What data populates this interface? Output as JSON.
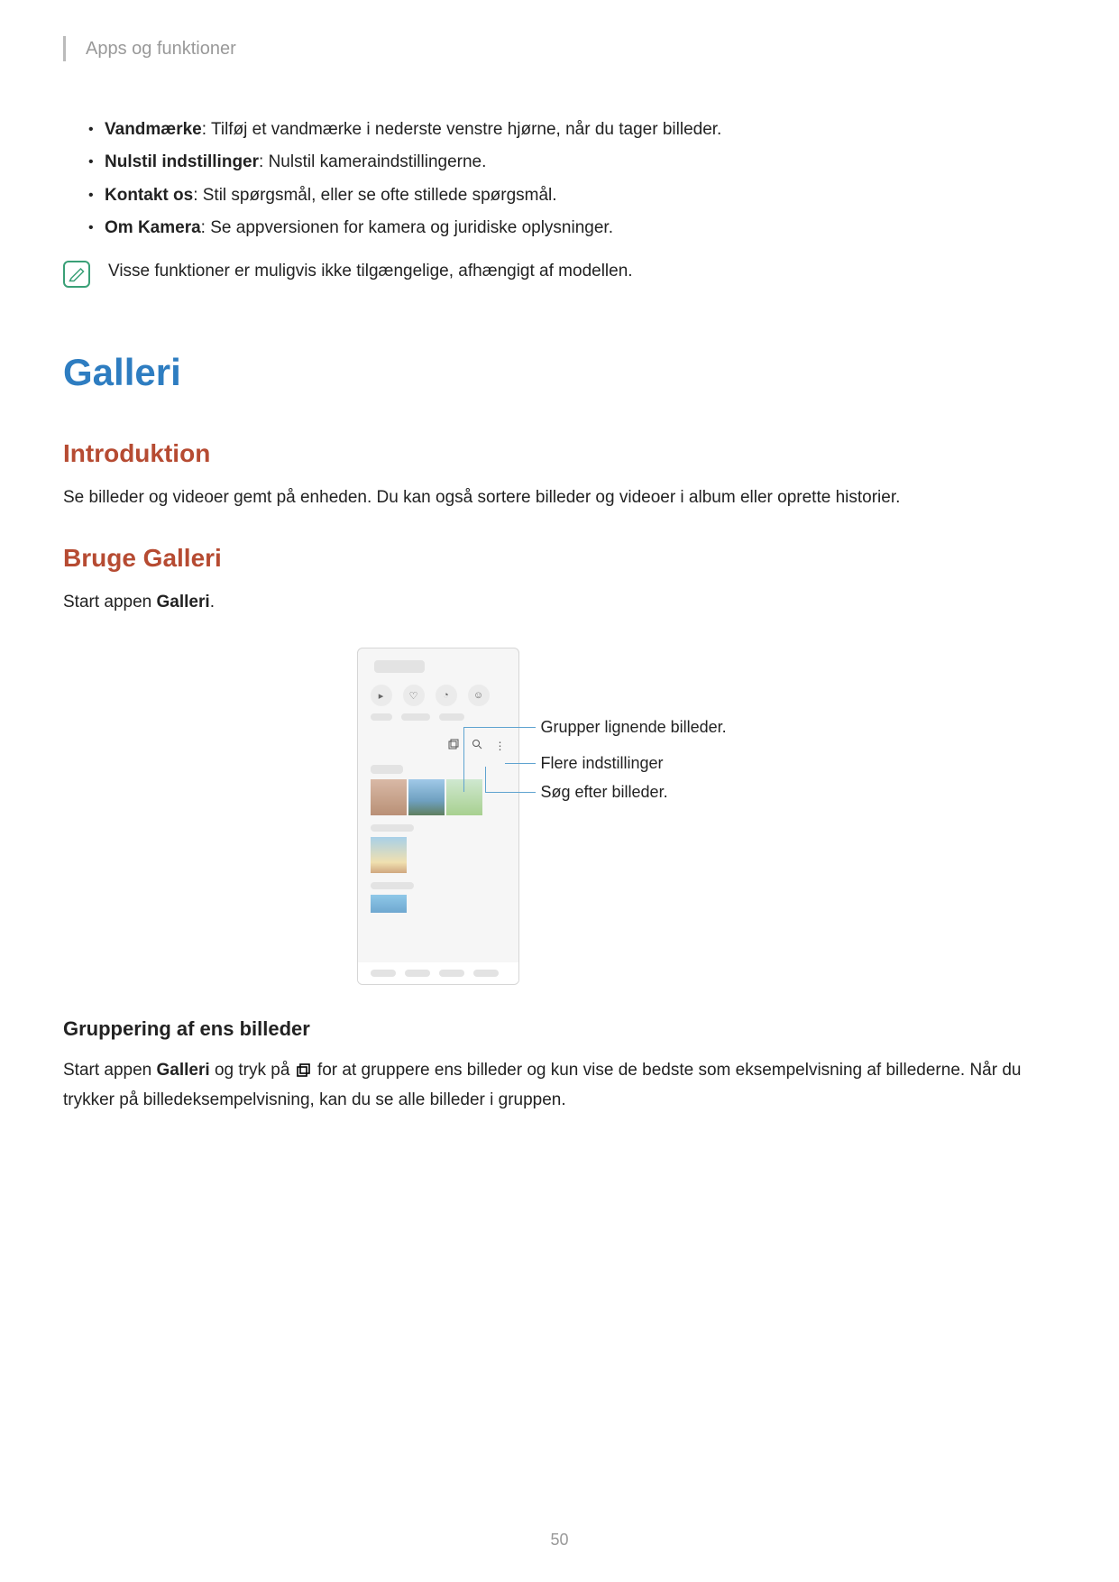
{
  "header": "Apps og funktioner",
  "bullets": [
    {
      "term": "Vandmærke",
      "desc": ": Tilføj et vandmærke i nederste venstre hjørne, når du tager billeder."
    },
    {
      "term": "Nulstil indstillinger",
      "desc": ": Nulstil kameraindstillingerne."
    },
    {
      "term": "Kontakt os",
      "desc": ": Stil spørgsmål, eller se ofte stillede spørgsmål."
    },
    {
      "term": "Om Kamera",
      "desc": ": Se appversionen for kamera og juridiske oplysninger."
    }
  ],
  "note": "Visse funktioner er muligvis ikke tilgængelige, afhængigt af modellen.",
  "h1": "Galleri",
  "intro": {
    "title": "Introduktion",
    "body": "Se billeder og videoer gemt på enheden. Du kan også sortere billeder og videoer i album eller oprette historier."
  },
  "use": {
    "title": "Bruge Galleri",
    "body_prefix": "Start appen ",
    "body_bold": "Galleri",
    "body_suffix": "."
  },
  "callouts": {
    "group": "Grupper lignende billeder.",
    "more": "Flere indstillinger",
    "search": "Søg efter billeder."
  },
  "grouping": {
    "title": "Gruppering af ens billeder",
    "p1_a": "Start appen ",
    "p1_b": "Galleri",
    "p1_c": " og tryk på ",
    "p1_d": " for at gruppere ens billeder og kun vise de bedste som eksempelvisning af billederne. Når du trykker på billedeksempelvisning, kan du se alle billeder i gruppen."
  },
  "page_number": "50"
}
